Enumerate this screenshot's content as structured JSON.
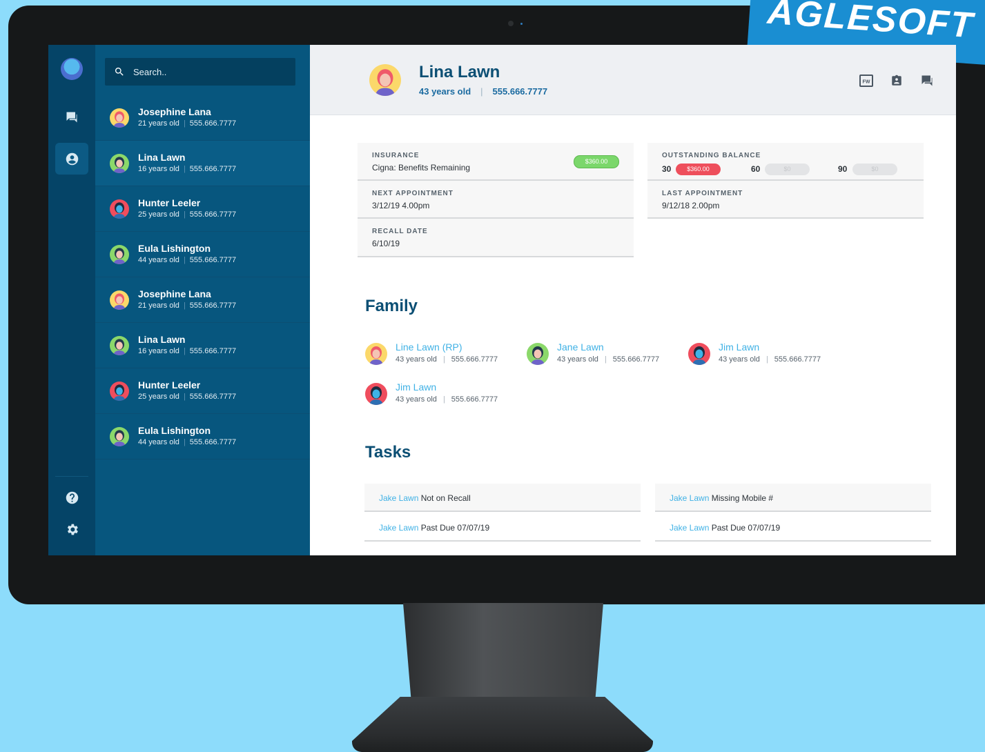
{
  "brand": {
    "text": "AGLESOFT"
  },
  "search": {
    "placeholder": "Search.."
  },
  "rail": {
    "icons": [
      "chat-icon",
      "user-icon",
      "help-icon",
      "settings-icon"
    ]
  },
  "patients": [
    {
      "name": "Josephine Lana",
      "age": "21 years old",
      "phone": "555.666.7777",
      "avatar": "female-red"
    },
    {
      "name": "Lina Lawn",
      "age": "16 years old",
      "phone": "555.666.7777",
      "avatar": "female-dark"
    },
    {
      "name": "Hunter Leeler",
      "age": "25 years old",
      "phone": "555.666.7777",
      "avatar": "male-red"
    },
    {
      "name": "Eula Lishington",
      "age": "44 years old",
      "phone": "555.666.7777",
      "avatar": "female-dark"
    },
    {
      "name": "Josephine Lana",
      "age": "21 years old",
      "phone": "555.666.7777",
      "avatar": "female-red"
    },
    {
      "name": "Lina Lawn",
      "age": "16 years old",
      "phone": "555.666.7777",
      "avatar": "female-dark"
    },
    {
      "name": "Hunter Leeler",
      "age": "25 years old",
      "phone": "555.666.7777",
      "avatar": "male-red"
    },
    {
      "name": "Eula Lishington",
      "age": "44 years old",
      "phone": "555.666.7777",
      "avatar": "female-dark"
    }
  ],
  "header": {
    "name": "Lina Lawn",
    "age": "43 years old",
    "phone": "555.666.7777",
    "sep": "|",
    "actions": [
      "fw-icon",
      "contact-card-icon",
      "chat-icon"
    ],
    "fw_label": "FW"
  },
  "insurance": {
    "label": "INSURANCE",
    "value": "Cigna: Benefits Remaining",
    "amount": "$360.00"
  },
  "outstanding": {
    "label": "OUTSTANDING BALANCE",
    "buckets": [
      {
        "days": "30",
        "amount": "$360.00"
      },
      {
        "days": "60",
        "amount": "$0"
      },
      {
        "days": "90",
        "amount": "$0"
      }
    ]
  },
  "next_appointment": {
    "label": "NEXT APPOINTMENT",
    "value": "3/12/19 4.00pm"
  },
  "last_appointment": {
    "label": "LAST APPOINTMENT",
    "value": "9/12/18 2.00pm"
  },
  "recall": {
    "label": "RECALL DATE",
    "value": "6/10/19"
  },
  "family": {
    "title": "Family",
    "members": [
      {
        "name": "Line Lawn (RP)",
        "age": "43 years old",
        "phone": "555.666.7777",
        "avatar": "female-red"
      },
      {
        "name": "Jane Lawn",
        "age": "43 years old",
        "phone": "555.666.7777",
        "avatar": "female-dark"
      },
      {
        "name": "Jim Lawn",
        "age": "43 years old",
        "phone": "555.666.7777",
        "avatar": "male-red"
      },
      {
        "name": "Jim Lawn",
        "age": "43 years old",
        "phone": "555.666.7777",
        "avatar": "male-red"
      }
    ]
  },
  "tasks": {
    "title": "Tasks",
    "left": [
      {
        "name": "Jake Lawn",
        "desc": "Not on Recall"
      },
      {
        "name": "Jake Lawn",
        "desc": "Past Due 07/07/19"
      }
    ],
    "right": [
      {
        "name": "Jake Lawn",
        "desc": "Missing Mobile #"
      },
      {
        "name": "Jake Lawn",
        "desc": "Past Due 07/07/19"
      }
    ]
  }
}
